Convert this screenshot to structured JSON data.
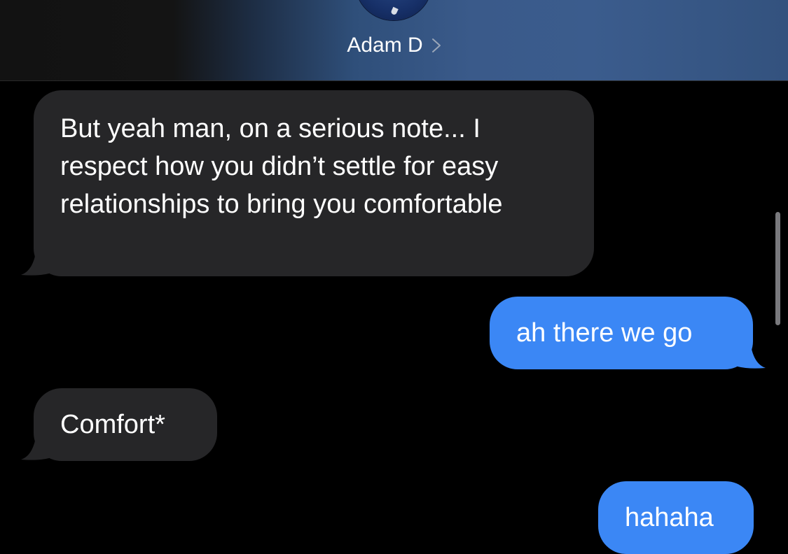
{
  "header": {
    "contact_name": "Adam D",
    "chevron_icon": "chevron-right-icon",
    "avatar_icon": "contact-avatar"
  },
  "messages": [
    {
      "direction": "incoming",
      "text": "But yeah man, on a serious note... I respect how you didn’t settle for easy relationships to bring you comfortable"
    },
    {
      "direction": "outgoing",
      "text": "ah there we go"
    },
    {
      "direction": "incoming",
      "text": "Comfort*"
    },
    {
      "direction": "outgoing",
      "text": "hahaha"
    }
  ],
  "colors": {
    "background": "#000000",
    "incoming_bubble": "#262628",
    "outgoing_bubble": "#3b87f5",
    "text": "#ffffff",
    "header_accent": "#3a5a8a"
  }
}
